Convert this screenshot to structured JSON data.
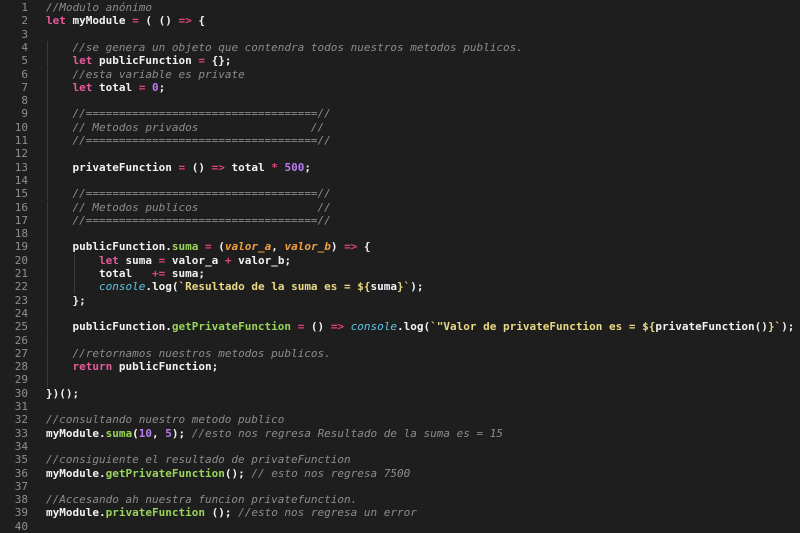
{
  "editor": {
    "colors": {
      "background": "#1e1e1e",
      "comment": "#8c8c8c",
      "keyword": "#e55a9a",
      "number": "#b97cf0",
      "string": "#e9d983",
      "console": "#5fc7e6",
      "method": "#9ad45a",
      "param": "#f0a040"
    },
    "lines": [
      {
        "num": "1",
        "indent": 0,
        "tokens": [
          {
            "t": "//Modulo anónimo",
            "c": "comment"
          }
        ]
      },
      {
        "num": "2",
        "indent": 0,
        "tokens": [
          {
            "t": "let",
            "c": "keyword"
          },
          {
            "t": " myModule ",
            "c": "plain"
          },
          {
            "t": "=",
            "c": "operator"
          },
          {
            "t": " ( () ",
            "c": "plain"
          },
          {
            "t": "=>",
            "c": "operator"
          },
          {
            "t": " {",
            "c": "plain"
          }
        ]
      },
      {
        "num": "3",
        "indent": 0,
        "tokens": []
      },
      {
        "num": "4",
        "indent": 1,
        "tokens": [
          {
            "t": "//se genera un objeto que contendra todos nuestros metodos publicos.",
            "c": "comment"
          }
        ]
      },
      {
        "num": "5",
        "indent": 1,
        "tokens": [
          {
            "t": "let",
            "c": "keyword"
          },
          {
            "t": " publicFunction ",
            "c": "plain"
          },
          {
            "t": "=",
            "c": "operator"
          },
          {
            "t": " {};",
            "c": "plain"
          }
        ]
      },
      {
        "num": "6",
        "indent": 1,
        "tokens": [
          {
            "t": "//esta variable es private",
            "c": "comment"
          }
        ]
      },
      {
        "num": "7",
        "indent": 1,
        "tokens": [
          {
            "t": "let",
            "c": "keyword"
          },
          {
            "t": " total ",
            "c": "plain"
          },
          {
            "t": "=",
            "c": "operator"
          },
          {
            "t": " ",
            "c": "plain"
          },
          {
            "t": "0",
            "c": "number"
          },
          {
            "t": ";",
            "c": "plain"
          }
        ]
      },
      {
        "num": "8",
        "indent": 1,
        "tokens": []
      },
      {
        "num": "9",
        "indent": 1,
        "tokens": [
          {
            "t": "//===================================//",
            "c": "comment"
          }
        ]
      },
      {
        "num": "10",
        "indent": 1,
        "tokens": [
          {
            "t": "// Metodos privados                 //",
            "c": "comment"
          }
        ]
      },
      {
        "num": "11",
        "indent": 1,
        "tokens": [
          {
            "t": "//===================================//",
            "c": "comment"
          }
        ]
      },
      {
        "num": "12",
        "indent": 1,
        "tokens": []
      },
      {
        "num": "13",
        "indent": 1,
        "tokens": [
          {
            "t": "privateFunction ",
            "c": "plain"
          },
          {
            "t": "=",
            "c": "operator"
          },
          {
            "t": " () ",
            "c": "plain"
          },
          {
            "t": "=>",
            "c": "operator"
          },
          {
            "t": " total ",
            "c": "plain"
          },
          {
            "t": "*",
            "c": "operator"
          },
          {
            "t": " ",
            "c": "plain"
          },
          {
            "t": "500",
            "c": "number"
          },
          {
            "t": ";",
            "c": "plain"
          }
        ]
      },
      {
        "num": "14",
        "indent": 1,
        "tokens": []
      },
      {
        "num": "15",
        "indent": 1,
        "tokens": [
          {
            "t": "//===================================//",
            "c": "comment"
          }
        ]
      },
      {
        "num": "16",
        "indent": 1,
        "tokens": [
          {
            "t": "// Metodos publicos                  //",
            "c": "comment"
          }
        ]
      },
      {
        "num": "17",
        "indent": 1,
        "tokens": [
          {
            "t": "//===================================//",
            "c": "comment"
          }
        ]
      },
      {
        "num": "18",
        "indent": 1,
        "tokens": []
      },
      {
        "num": "19",
        "indent": 1,
        "tokens": [
          {
            "t": "publicFunction",
            "c": "plain"
          },
          {
            "t": ".",
            "c": "plain"
          },
          {
            "t": "suma",
            "c": "method"
          },
          {
            "t": " ",
            "c": "plain"
          },
          {
            "t": "=",
            "c": "operator"
          },
          {
            "t": " (",
            "c": "plain"
          },
          {
            "t": "valor_a",
            "c": "param"
          },
          {
            "t": ", ",
            "c": "plain"
          },
          {
            "t": "valor_b",
            "c": "param"
          },
          {
            "t": ") ",
            "c": "plain"
          },
          {
            "t": "=>",
            "c": "operator"
          },
          {
            "t": " {",
            "c": "plain"
          }
        ]
      },
      {
        "num": "20",
        "indent": 2,
        "tokens": [
          {
            "t": "let",
            "c": "keyword"
          },
          {
            "t": " suma ",
            "c": "plain"
          },
          {
            "t": "=",
            "c": "operator"
          },
          {
            "t": " valor_a ",
            "c": "plain"
          },
          {
            "t": "+",
            "c": "operator"
          },
          {
            "t": " valor_b;",
            "c": "plain"
          }
        ]
      },
      {
        "num": "21",
        "indent": 2,
        "tokens": [
          {
            "t": "total   ",
            "c": "plain"
          },
          {
            "t": "+=",
            "c": "operator"
          },
          {
            "t": " suma;",
            "c": "plain"
          }
        ]
      },
      {
        "num": "22",
        "indent": 2,
        "tokens": [
          {
            "t": "console",
            "c": "console"
          },
          {
            "t": ".log(",
            "c": "plain"
          },
          {
            "t": "`Resultado de la suma es = ${",
            "c": "string"
          },
          {
            "t": "suma",
            "c": "plain"
          },
          {
            "t": "}`",
            "c": "string"
          },
          {
            "t": ");",
            "c": "plain"
          }
        ]
      },
      {
        "num": "23",
        "indent": 1,
        "tokens": [
          {
            "t": "};",
            "c": "plain"
          }
        ]
      },
      {
        "num": "24",
        "indent": 1,
        "tokens": []
      },
      {
        "num": "25",
        "indent": 1,
        "tokens": [
          {
            "t": "publicFunction",
            "c": "plain"
          },
          {
            "t": ".",
            "c": "plain"
          },
          {
            "t": "getPrivateFunction",
            "c": "method"
          },
          {
            "t": " ",
            "c": "plain"
          },
          {
            "t": "=",
            "c": "operator"
          },
          {
            "t": " () ",
            "c": "plain"
          },
          {
            "t": "=>",
            "c": "operator"
          },
          {
            "t": " ",
            "c": "plain"
          },
          {
            "t": "console",
            "c": "console"
          },
          {
            "t": ".log(",
            "c": "plain"
          },
          {
            "t": "`\"Valor de privateFunction es = ${",
            "c": "string"
          },
          {
            "t": "privateFunction()",
            "c": "plain"
          },
          {
            "t": "}`",
            "c": "string"
          },
          {
            "t": ");",
            "c": "plain"
          }
        ]
      },
      {
        "num": "26",
        "indent": 1,
        "tokens": []
      },
      {
        "num": "27",
        "indent": 1,
        "tokens": [
          {
            "t": "//retornamos nuestros metodos publicos.",
            "c": "comment"
          }
        ]
      },
      {
        "num": "28",
        "indent": 1,
        "tokens": [
          {
            "t": "return",
            "c": "keyword"
          },
          {
            "t": " publicFunction;",
            "c": "plain"
          }
        ]
      },
      {
        "num": "29",
        "indent": 1,
        "tokens": []
      },
      {
        "num": "30",
        "indent": 0,
        "tokens": [
          {
            "t": "})();",
            "c": "plain"
          }
        ]
      },
      {
        "num": "31",
        "indent": 0,
        "tokens": []
      },
      {
        "num": "32",
        "indent": 0,
        "tokens": [
          {
            "t": "//consultando nuestro metodo publico",
            "c": "comment"
          }
        ]
      },
      {
        "num": "33",
        "indent": 0,
        "tokens": [
          {
            "t": "myModule",
            "c": "plain"
          },
          {
            "t": ".",
            "c": "plain"
          },
          {
            "t": "suma",
            "c": "method"
          },
          {
            "t": "(",
            "c": "plain"
          },
          {
            "t": "10",
            "c": "number"
          },
          {
            "t": ", ",
            "c": "plain"
          },
          {
            "t": "5",
            "c": "number"
          },
          {
            "t": "); ",
            "c": "plain"
          },
          {
            "t": "//esto nos regresa Resultado de la suma es = 15",
            "c": "comment"
          }
        ]
      },
      {
        "num": "34",
        "indent": 0,
        "tokens": []
      },
      {
        "num": "35",
        "indent": 0,
        "tokens": [
          {
            "t": "//consiguiente el resultado de privateFunction",
            "c": "comment"
          }
        ]
      },
      {
        "num": "36",
        "indent": 0,
        "tokens": [
          {
            "t": "myModule",
            "c": "plain"
          },
          {
            "t": ".",
            "c": "plain"
          },
          {
            "t": "getPrivateFunction",
            "c": "method"
          },
          {
            "t": "(); ",
            "c": "plain"
          },
          {
            "t": "// esto nos regresa 7500",
            "c": "comment"
          }
        ]
      },
      {
        "num": "37",
        "indent": 0,
        "tokens": []
      },
      {
        "num": "38",
        "indent": 0,
        "tokens": [
          {
            "t": "//Accesando ah nuestra funcion privatefunction.",
            "c": "comment"
          }
        ]
      },
      {
        "num": "39",
        "indent": 0,
        "tokens": [
          {
            "t": "myModule",
            "c": "plain"
          },
          {
            "t": ".",
            "c": "plain"
          },
          {
            "t": "privateFunction",
            "c": "method"
          },
          {
            "t": " (); ",
            "c": "plain"
          },
          {
            "t": "//esto nos regresa un error",
            "c": "comment"
          }
        ]
      },
      {
        "num": "40",
        "indent": 0,
        "tokens": []
      }
    ]
  }
}
